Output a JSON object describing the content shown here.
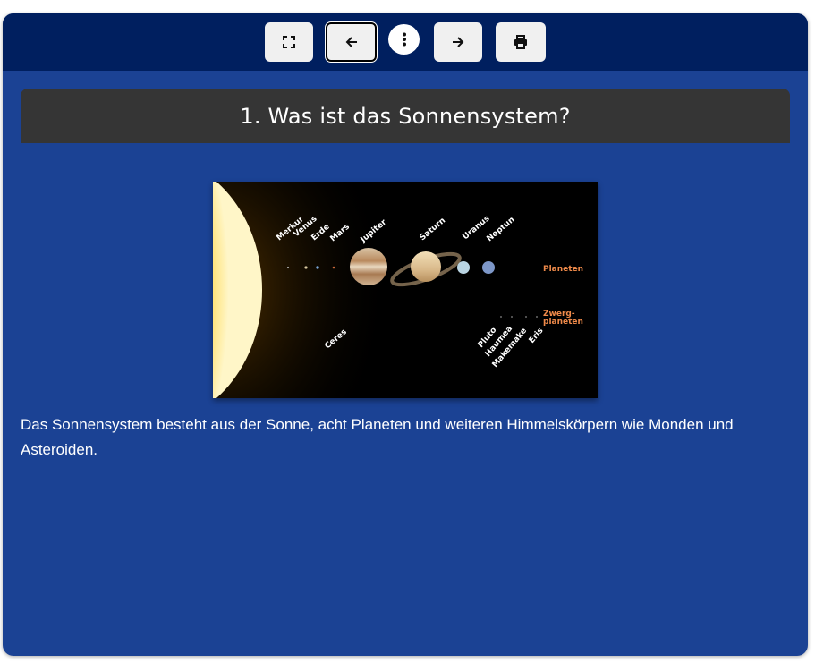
{
  "toolbar": {
    "buttons": [
      {
        "name": "fullscreen",
        "icon": "fullscreen-icon"
      },
      {
        "name": "back",
        "icon": "arrow-left-icon"
      },
      {
        "name": "more",
        "icon": "more-vertical-icon"
      },
      {
        "name": "forward",
        "icon": "arrow-right-icon"
      },
      {
        "name": "print",
        "icon": "printer-icon"
      }
    ]
  },
  "section": {
    "title": "1. Was ist das Sonnensystem?",
    "text": "Das Sonnensystem besteht aus der Sonne, acht Planeten und weiteren Himmelskörpern wie Monden und Asteroiden."
  },
  "figure": {
    "planet_labels": [
      "Merkur",
      "Venus",
      "Erde",
      "Mars",
      "Jupiter",
      "Saturn",
      "Uranus",
      "Neptun"
    ],
    "dwarf_labels": [
      "Ceres",
      "Pluto",
      "Haumea",
      "Makemake",
      "Eris"
    ],
    "planeten_label": "Planeten",
    "zwerg_label_1": "Zwerg-",
    "zwerg_label_2": "planeten"
  },
  "colors": {
    "toolbar": "#001f5f",
    "panel": "#1b4294",
    "title_bar": "#353535",
    "accent_label": "#ef8a4a"
  }
}
